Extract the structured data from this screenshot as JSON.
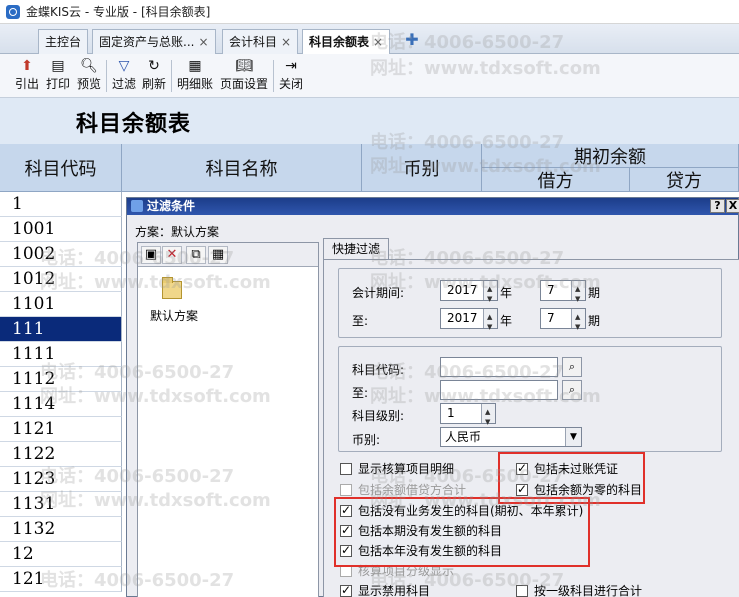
{
  "window": {
    "title": "金蝶KIS云 - 专业版 - [科目余额表]"
  },
  "tabs": [
    {
      "label": "主控台",
      "closable": false
    },
    {
      "label": "固定资产与总账...",
      "closable": true
    },
    {
      "label": "会计科目",
      "closable": true
    },
    {
      "label": "科目余额表",
      "closable": true,
      "active": true
    }
  ],
  "tab_close_glyph": "×",
  "tab_add_glyph": "✚",
  "toolbar": {
    "export": "引出",
    "print": "打印",
    "preview": "预览",
    "filter": "过滤",
    "refresh": "刷新",
    "detail": "明细账",
    "page_setup": "页面设置",
    "close": "关闭"
  },
  "report": {
    "title": "科目余额表",
    "headers": {
      "code": "科目代码",
      "name": "科目名称",
      "currency": "币别",
      "opening": "期初余额",
      "debit": "借方",
      "credit": "贷方"
    },
    "codes": [
      "1",
      "1001",
      "1002",
      "1012",
      "1101",
      "111",
      "1111",
      "1112",
      "1114",
      "1121",
      "1122",
      "1123",
      "1131",
      "1132",
      "12",
      "121"
    ],
    "selected_code": "111"
  },
  "watermark": {
    "phone": "电话：4006-6500-27",
    "site": "网址：www.tdxsoft.com"
  },
  "dialog": {
    "title": "过滤条件",
    "help_btn": "?",
    "close_btn": "X",
    "scheme_label": "方案：默认方案",
    "scheme_item": "默认方案",
    "quick_tab": "快捷过滤",
    "period_label": "会计期间:",
    "to_label": "至:",
    "year_unit": "年",
    "period_unit": "期",
    "from_year": "2017",
    "from_period": "7",
    "to_year": "2017",
    "to_period": "7",
    "account_code_label": "科目代码:",
    "account_to_label": "至:",
    "level_label": "科目级别:",
    "level_value": "1",
    "currency_label": "币别:",
    "currency_value": "人民币",
    "checkboxes": {
      "show_aux": {
        "label": "显示核算项目明细",
        "checked": false,
        "disabled": false
      },
      "include_unposted": {
        "label": "包括未过账凭证",
        "checked": true,
        "disabled": false
      },
      "include_balance_sum": {
        "label": "包括余额借贷方合计",
        "checked": false,
        "disabled": true
      },
      "include_zero_balance": {
        "label": "包括余额为零的科目",
        "checked": true,
        "disabled": false
      },
      "include_no_business": {
        "label": "包括没有业务发生的科目(期初、本年累计)",
        "checked": true,
        "disabled": false
      },
      "include_no_period_amount": {
        "label": "包括本期没有发生额的科目",
        "checked": true,
        "disabled": false
      },
      "include_no_year_amount": {
        "label": "包括本年没有发生额的科目",
        "checked": true,
        "disabled": false
      },
      "aux_separate": {
        "label": "核算项目分级显示",
        "checked": false,
        "disabled": true
      },
      "show_disabled": {
        "label": "显示禁用科目",
        "checked": true,
        "disabled": false
      },
      "sum_by_first_level": {
        "label": "按一级科目进行合计",
        "checked": false,
        "disabled": false
      }
    }
  },
  "colors": {
    "accent": "#2f56ad",
    "selected_row": "#0a2a7a",
    "highlight": "#e0302a",
    "header_bg": "#c6d7ec"
  }
}
